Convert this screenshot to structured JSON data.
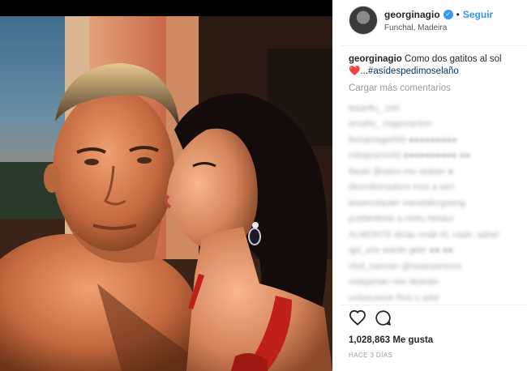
{
  "post": {
    "username": "georginagio",
    "follow_label": "Seguir",
    "location": "Funchal, Madeira",
    "caption_user": "georginagio",
    "caption_text": "Como dos gatitos al sol",
    "caption_emoji": "❤️",
    "caption_ellipsis": "...",
    "caption_hashtag": "#asídespedimoselaño",
    "load_more": "Cargar más comentarios",
    "likes": "1,028,863 Me gusta",
    "time_ago": "HACE 3 DÍAS"
  },
  "comments_blurred": [
    "lesarifu_ 100",
    "arsafio_ mapovanton",
    "fornarosgo000 ●●●●●●●●●",
    "robajoanm00 ●●●●●●●●●● ●●",
    "flauto @sano.mu seaser ●",
    "desmitomadore mos a serr",
    "lesemotauter  mendaforgoong",
    "puslandone a motu nesaur",
    "ALMONTE dinas unde Al, vado, adnel",
    "qpl_unx wardo geer ●● ●●",
    "vlod_kaonan @saaeaarsnos",
    "vsiagonan nos deanan",
    "unlasusese Ros u ador"
  ],
  "colors": {
    "link": "#3897f0",
    "hashtag": "#003569",
    "muted": "#999999"
  },
  "icons": [
    "verified-badge-icon",
    "heart-icon",
    "comment-icon"
  ]
}
